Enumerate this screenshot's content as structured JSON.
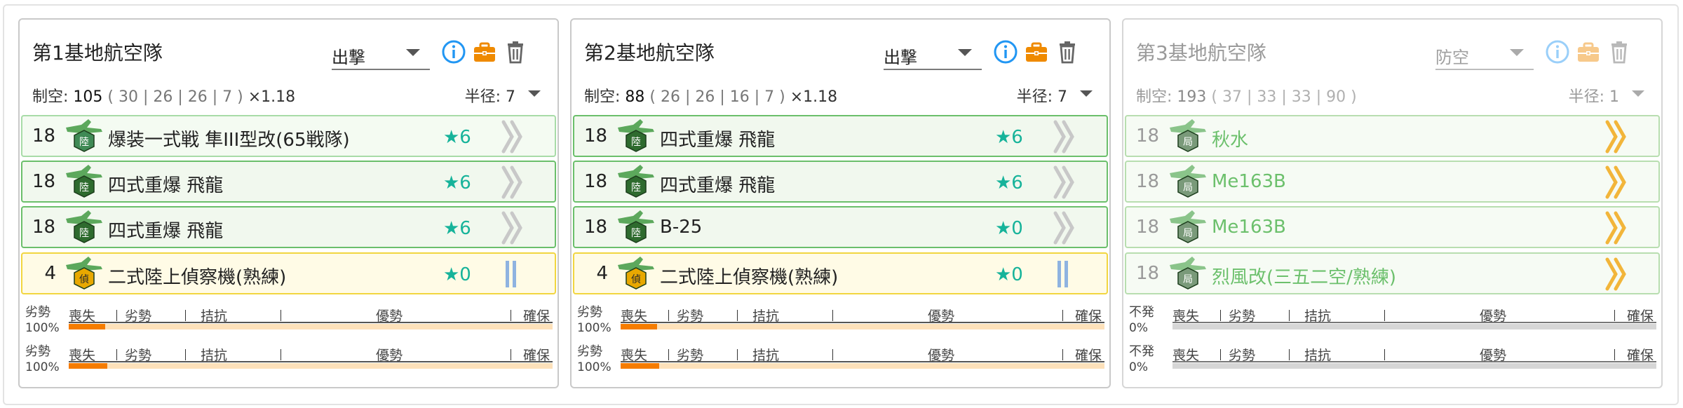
{
  "colors": {
    "accent_blue": "#2196f3",
    "briefcase_orange": "#ef8a00",
    "star_teal": "#16b39a",
    "slot_green_border": "#6bbf6b",
    "slot_yellow_border": "#f2d640",
    "bar_fill_orange": "#f57c00",
    "bar_track_peach": "#fde1ba"
  },
  "panels": [
    {
      "title": "第1基地航空隊",
      "mode": "出撃",
      "air_power_label": "制空:",
      "air_power": "105",
      "breakdown": "( 30 | 26 | 26 | 7 )",
      "multiplier": "×1.18",
      "radius_label": "半径:",
      "radius": "7",
      "slots": [
        {
          "count": "18",
          "icon": "army-fighter-icon",
          "name": "爆装一式戦 隼III型改(65戦隊)",
          "star": "★6",
          "prof": "chevron-max-icon",
          "style": "light"
        },
        {
          "count": "18",
          "icon": "army-bomber-icon",
          "name": "四式重爆 飛龍",
          "star": "★6",
          "prof": "chevron-max-icon",
          "style": "green"
        },
        {
          "count": "18",
          "icon": "army-bomber-icon",
          "name": "四式重爆 飛龍",
          "star": "★6",
          "prof": "chevron-max-icon",
          "style": "green"
        },
        {
          "count": "4",
          "icon": "land-recon-icon",
          "name": "二式陸上偵察機(熟練)",
          "star": "★0",
          "prof": "double-bar-icon",
          "style": "yellow"
        }
      ],
      "bars": [
        {
          "status": "劣勢",
          "percent": "100%",
          "fill": 0.075
        },
        {
          "status": "劣勢",
          "percent": "100%",
          "fill": 0.08
        }
      ]
    },
    {
      "title": "第2基地航空隊",
      "mode": "出撃",
      "air_power_label": "制空:",
      "air_power": "88",
      "breakdown": "( 26 | 26 | 16 | 7 )",
      "multiplier": "×1.18",
      "radius_label": "半径:",
      "radius": "7",
      "slots": [
        {
          "count": "18",
          "icon": "army-bomber-icon",
          "name": "四式重爆 飛龍",
          "star": "★6",
          "prof": "chevron-max-icon",
          "style": "green"
        },
        {
          "count": "18",
          "icon": "army-bomber-icon",
          "name": "四式重爆 飛龍",
          "star": "★6",
          "prof": "chevron-max-icon",
          "style": "green"
        },
        {
          "count": "18",
          "icon": "army-bomber-icon",
          "name": "B-25",
          "star": "★0",
          "prof": "chevron-max-icon",
          "style": "green"
        },
        {
          "count": "4",
          "icon": "land-recon-icon",
          "name": "二式陸上偵察機(熟練)",
          "star": "★0",
          "prof": "double-bar-icon",
          "style": "yellow"
        }
      ],
      "bars": [
        {
          "status": "劣勢",
          "percent": "100%",
          "fill": 0.075
        },
        {
          "status": "劣勢",
          "percent": "100%",
          "fill": 0.08
        }
      ]
    },
    {
      "title": "第3基地航空隊",
      "mode": "防空",
      "air_power_label": "制空:",
      "air_power": "193",
      "breakdown": "( 37 | 33 | 33 | 90 )",
      "multiplier": "",
      "radius_label": "半径:",
      "radius": "1",
      "slots": [
        {
          "count": "18",
          "icon": "interceptor-icon",
          "name": "秋水",
          "star": "",
          "prof": "chevron-gold-icon",
          "style": "faded"
        },
        {
          "count": "18",
          "icon": "interceptor-icon",
          "name": "Me163B",
          "star": "",
          "prof": "chevron-gold-icon",
          "style": "faded"
        },
        {
          "count": "18",
          "icon": "interceptor-icon",
          "name": "Me163B",
          "star": "",
          "prof": "chevron-gold-icon",
          "style": "faded"
        },
        {
          "count": "18",
          "icon": "interceptor-icon",
          "name": "烈風改(三五二空/熟練)",
          "star": "",
          "prof": "chevron-gold-icon",
          "style": "faded"
        }
      ],
      "bars": [
        {
          "status": "不発",
          "percent": "0%",
          "fill": 0
        },
        {
          "status": "不発",
          "percent": "0%",
          "fill": 0
        }
      ]
    }
  ],
  "bar_scale": {
    "labels": [
      "喪失",
      "劣勢",
      "拮抗",
      "優勢",
      "確保"
    ]
  }
}
